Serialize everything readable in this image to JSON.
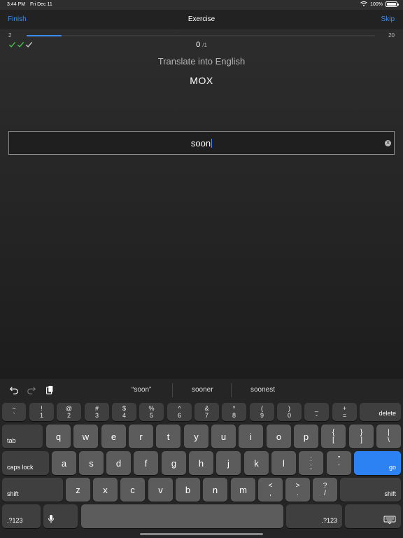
{
  "status": {
    "time": "3:44 PM",
    "date": "Fri Dec 11",
    "battery": "100%"
  },
  "nav": {
    "finish": "Finish",
    "title": "Exercise",
    "skip": "Skip"
  },
  "progress": {
    "start": "2",
    "end": "20",
    "fraction": 0.1
  },
  "score": {
    "value": "0",
    "total": "/1"
  },
  "prompt": "Translate into English",
  "word": "MOX",
  "answer": {
    "value": "soon"
  },
  "suggestions": [
    "“soon”",
    "sooner",
    "soonest"
  ],
  "keyboard": {
    "row1": [
      {
        "top": "~",
        "bottom": "`"
      },
      {
        "top": "!",
        "bottom": "1"
      },
      {
        "top": "@",
        "bottom": "2"
      },
      {
        "top": "#",
        "bottom": "3"
      },
      {
        "top": "$",
        "bottom": "4"
      },
      {
        "top": "%",
        "bottom": "5"
      },
      {
        "top": "^",
        "bottom": "6"
      },
      {
        "top": "&",
        "bottom": "7"
      },
      {
        "top": "*",
        "bottom": "8"
      },
      {
        "top": "(",
        "bottom": "9"
      },
      {
        "top": ")",
        "bottom": "0"
      },
      {
        "top": "_",
        "bottom": "-"
      },
      {
        "top": "+",
        "bottom": "="
      }
    ],
    "delete": "delete",
    "tab": "tab",
    "row2": [
      "q",
      "w",
      "e",
      "r",
      "t",
      "y",
      "u",
      "i",
      "o",
      "p"
    ],
    "row2_sym": [
      {
        "top": "{",
        "bottom": "["
      },
      {
        "top": "}",
        "bottom": "]"
      },
      {
        "top": "|",
        "bottom": "\\"
      }
    ],
    "caps": "caps lock",
    "row3": [
      "a",
      "s",
      "d",
      "f",
      "g",
      "h",
      "j",
      "k",
      "l"
    ],
    "row3_sym": [
      {
        "top": ":",
        "bottom": ";"
      },
      {
        "top": "”",
        "bottom": "’"
      }
    ],
    "go": "go",
    "shift": "shift",
    "row4": [
      "z",
      "x",
      "c",
      "v",
      "b",
      "n",
      "m"
    ],
    "row4_sym": [
      {
        "top": "<",
        "bottom": ","
      },
      {
        "top": ">",
        "bottom": "."
      },
      {
        "top": "?",
        "bottom": "/"
      }
    ],
    "numbers": ".?123"
  },
  "colors": {
    "accent": "#3b8cf0",
    "go": "#2d82f3",
    "key": "#5c5c5c",
    "key_dark": "#3f3f3f"
  }
}
